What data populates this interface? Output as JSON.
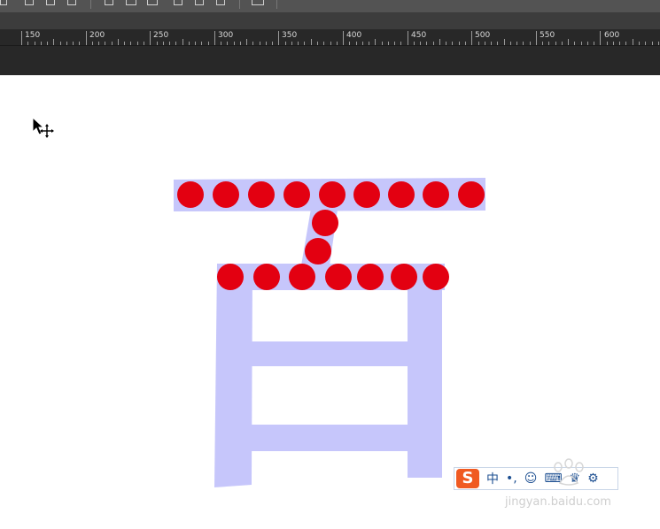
{
  "ruler": {
    "labels": [
      "150",
      "200",
      "250",
      "300",
      "350",
      "400",
      "450",
      "500",
      "550",
      "600"
    ]
  },
  "colors": {
    "toolbar": "#535353",
    "ruler_bg": "#282828",
    "glyph_fill": "#c6c6fb",
    "dot_fill": "#e30011",
    "canvas": "#ffffff"
  },
  "icons": {
    "cursor": "move-cursor-icon",
    "ime": "sogou-ime-icon"
  },
  "ime": {
    "logo_letter": "S",
    "glyph_1": "中",
    "glyph_2": "•,",
    "glyph_3": "☺",
    "glyph_4": "⌨",
    "glyph_5": "♛",
    "glyph_6": "⚙"
  },
  "watermark": {
    "text": "jingyan.baidu.com"
  }
}
